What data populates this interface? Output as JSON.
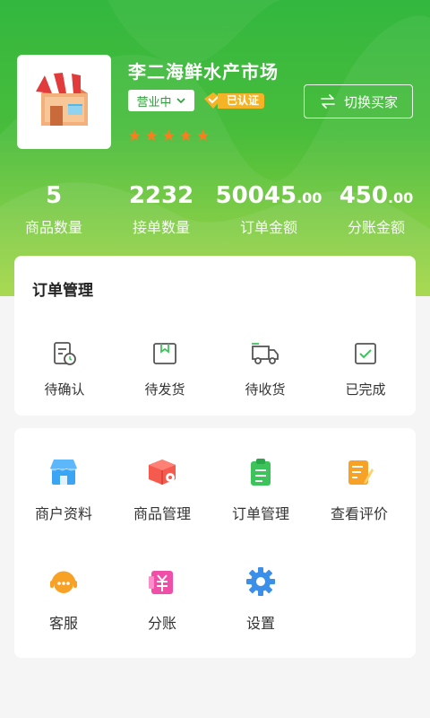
{
  "shop": {
    "name": "李二海鲜水产市场",
    "status": "营业中",
    "verified_label": "已认证",
    "rating_stars": 5
  },
  "switch_button": {
    "label": "切换买家"
  },
  "stats": [
    {
      "int": "5",
      "dec": "",
      "label": "商品数量"
    },
    {
      "int": "2232",
      "dec": "",
      "label": "接单数量"
    },
    {
      "int": "50045",
      "dec": ".00",
      "label": "订单金额"
    },
    {
      "int": "450",
      "dec": ".00",
      "label": "分账金额"
    }
  ],
  "order_section": {
    "title": "订单管理",
    "items": [
      {
        "label": "待确认",
        "icon": "pending-confirm-icon"
      },
      {
        "label": "待发货",
        "icon": "to-ship-icon"
      },
      {
        "label": "待收货",
        "icon": "to-receive-icon"
      },
      {
        "label": "已完成",
        "icon": "completed-icon"
      }
    ]
  },
  "menu": [
    {
      "label": "商户资料",
      "icon": "store-icon",
      "color": "#3ba5f5"
    },
    {
      "label": "商品管理",
      "icon": "product-box-icon",
      "color": "#f55a4e"
    },
    {
      "label": "订单管理",
      "icon": "clipboard-icon",
      "color": "#3cc45b"
    },
    {
      "label": "查看评价",
      "icon": "review-icon",
      "color": "#f7a127"
    },
    {
      "label": "客服",
      "icon": "customer-service-icon",
      "color": "#f7a127"
    },
    {
      "label": "分账",
      "icon": "split-bill-icon",
      "color": "#ef4fa6"
    },
    {
      "label": "设置",
      "icon": "settings-gear-icon",
      "color": "#3b8fe8"
    }
  ],
  "colors": {
    "primary_green": "#33b73e",
    "star_orange": "#ff7b1c",
    "badge_gold": "#f5b326"
  }
}
